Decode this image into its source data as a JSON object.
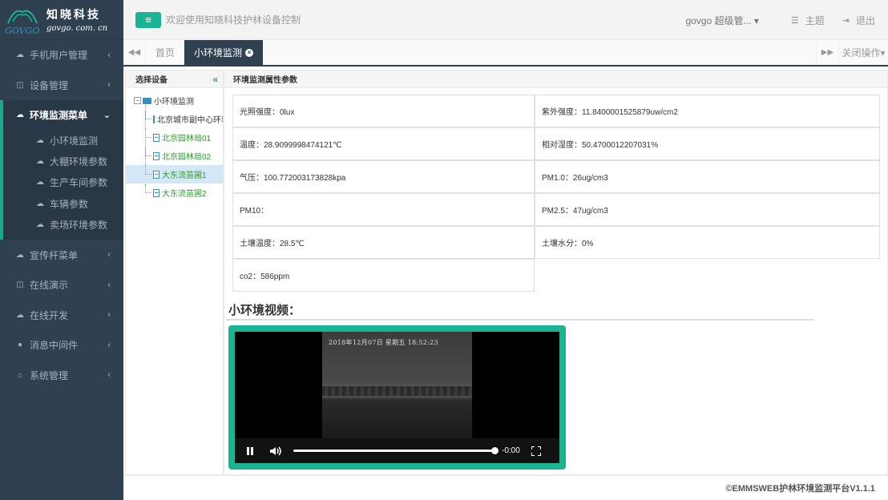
{
  "brand": {
    "cn": "知晓科技",
    "en": "govgo. com. cn",
    "logo_text": "GOVGO"
  },
  "sidebar": {
    "items": [
      {
        "label": "手机用户管理",
        "icon": "cloud-icon"
      },
      {
        "label": "设备管理",
        "icon": "columns-icon"
      }
    ],
    "active_group": {
      "label": "环境监测菜单",
      "icon": "cloud-icon",
      "children": [
        "小环境监测",
        "大棚环境参数",
        "生产车间参数",
        "车辆参数",
        "卖场环境参数"
      ]
    },
    "items_after": [
      {
        "label": "宣传杆菜单",
        "icon": "cloud-icon"
      },
      {
        "label": "在线演示",
        "icon": "columns-icon"
      },
      {
        "label": "在线开发",
        "icon": "cloud-icon"
      },
      {
        "label": "消息中间件",
        "icon": "comment-icon"
      },
      {
        "label": "系统管理",
        "icon": "home-icon"
      }
    ]
  },
  "topbar": {
    "toggle_icon": "≡",
    "welcome": "欢迎使用知晓科技护林设备控制",
    "user": "govgo 超级管...",
    "theme": "主题",
    "logout": "退出"
  },
  "tabs": {
    "home": "首页",
    "active": "小环境监测",
    "close_ops": "关闭操作"
  },
  "tree": {
    "header": "选择设备",
    "root": "小环境监测",
    "children": [
      "北京城市副中心环境监测",
      "北京园林局01",
      "北京园林局02",
      "大东流苗圃1",
      "大东流苗圃2"
    ],
    "selected_index": 3
  },
  "params": {
    "header": "环境监测属性参数",
    "cells": [
      "光照强度：0lux",
      "紫外强度：11.8400001525879uw/cm2",
      "温度：28.9099998474121℃",
      "相对湿度：50.4700012207031%",
      "气压：100.772003173828kpa",
      "PM1.0：26ug/cm3",
      "PM10：",
      "PM2.5：47ug/cm3",
      "土壤温度：28.5℃",
      "土壤水分：0%",
      "co2：586ppm"
    ]
  },
  "video": {
    "title": "小环境视频：",
    "osd": "2018年12月07日  星期五  18:52:23",
    "time": "-0:00",
    "progress": 1.0
  },
  "footer": "©EMMSWEB护林环境监测平台V1.1.1"
}
